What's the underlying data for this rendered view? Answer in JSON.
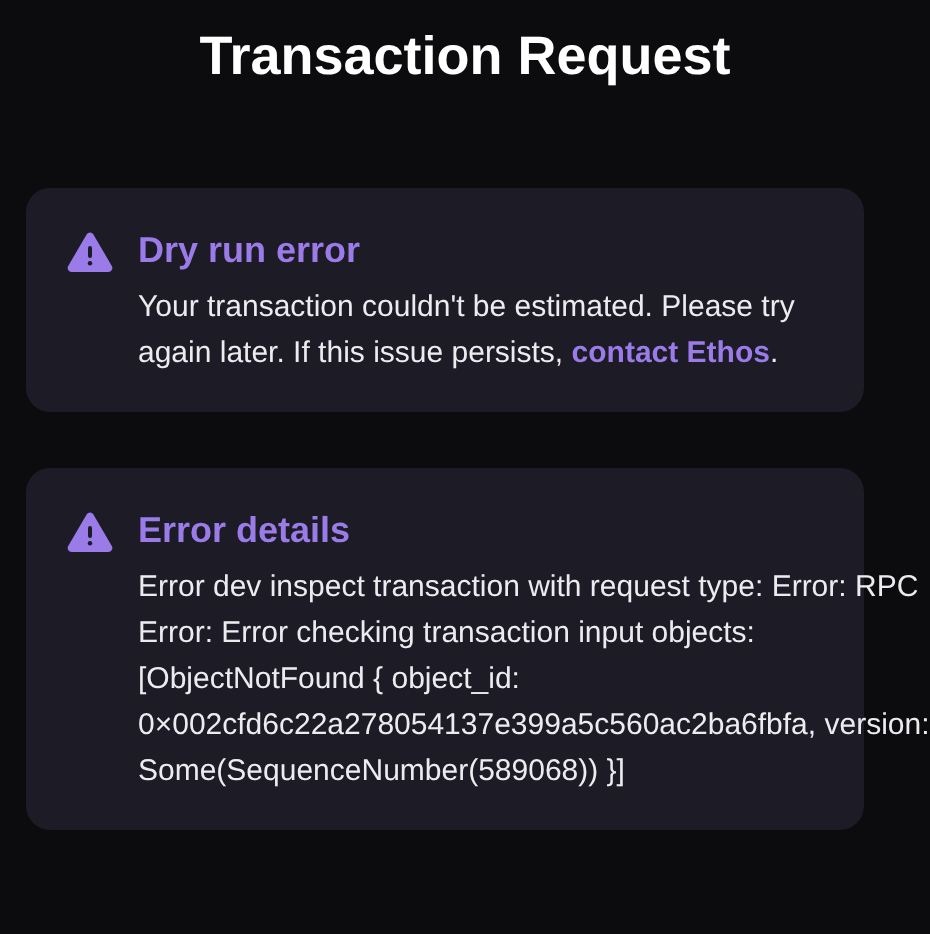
{
  "title": "Transaction Request",
  "alerts": [
    {
      "kind": "link",
      "title": "Dry run error",
      "message": "Your transaction couldn't be estimated. Please try again later. If this issue persists,",
      "link": "contact Ethos",
      "after": "."
    },
    {
      "kind": "plain",
      "title": "Error details",
      "message": "Error dev inspect transaction with request type: Error: RPC Error: Error checking transaction input objects: [ObjectNotFound { object_id: 0×002cfd6c22a278054137e399a5c560ac2ba6fbfa, version: Some(SequenceNumber(589068)) }]"
    }
  ]
}
